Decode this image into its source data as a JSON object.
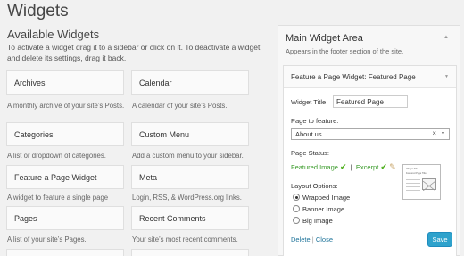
{
  "page": {
    "title": "Widgets"
  },
  "available": {
    "title": "Available Widgets",
    "description": "To activate a widget drag it to a sidebar or click on it. To deactivate a widget and delete its settings, drag it back.",
    "widgets": [
      {
        "name": "Archives",
        "desc": "A monthly archive of your site’s Posts."
      },
      {
        "name": "Calendar",
        "desc": "A calendar of your site’s Posts."
      },
      {
        "name": "Categories",
        "desc": "A list or dropdown of categories."
      },
      {
        "name": "Custom Menu",
        "desc": "Add a custom menu to your sidebar."
      },
      {
        "name": "Feature a Page Widget",
        "desc": "A widget to feature a single page"
      },
      {
        "name": "Meta",
        "desc": "Login, RSS, & WordPress.org links."
      },
      {
        "name": "Pages",
        "desc": "A list of your site’s Pages."
      },
      {
        "name": "Recent Comments",
        "desc": "Your site’s most recent comments."
      }
    ]
  },
  "sidebar": {
    "title": "Main Widget Area",
    "description": "Appears in the footer section of the site.",
    "widget": {
      "header": "Feature a Page Widget: Featured Page",
      "title_label": "Widget Title",
      "title_value": "Featured Page",
      "page_label": "Page to feature:",
      "page_value": "About us",
      "status_label": "Page Status:",
      "featured_image": "Featured Image",
      "excerpt": "Excerpt",
      "separator": "|",
      "layout_label": "Layout Options:",
      "layout_options": [
        "Wrapped Image",
        "Banner Image",
        "Big Image"
      ],
      "selected_layout": 0,
      "thumb_text": [
        "Widget Title",
        "Featured Page Title"
      ],
      "delete": "Delete",
      "close": "Close",
      "save": "Save"
    }
  },
  "colors": {
    "accent": "#2ea2cc",
    "ok": "#3a9b2a",
    "link": "#21759b"
  },
  "icons": [
    "check-icon",
    "pencil-icon",
    "collapse-arrow-icon",
    "clear-icon",
    "dropdown-caret-icon"
  ]
}
